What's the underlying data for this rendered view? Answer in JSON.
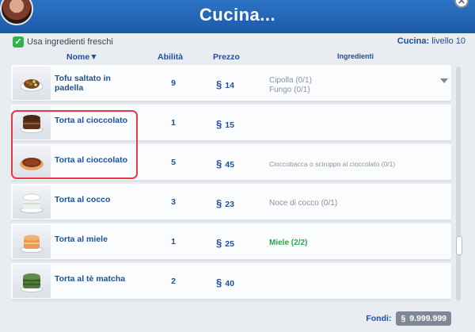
{
  "window": {
    "title": "Cucina...",
    "close_icon": "close-icon"
  },
  "options": {
    "fresh_label": "Usa ingredienti freschi",
    "fresh_checked": true
  },
  "skill": {
    "label": "Cucina:",
    "value": "livello 10"
  },
  "columns": {
    "name": "Nome",
    "skill": "Abilità",
    "price": "Prezzo",
    "ingredients": "Ingredienti"
  },
  "currency": "§",
  "recipes": [
    {
      "name": "Tofu saltato in padella",
      "skill": "9",
      "price": "14",
      "ingredients": [
        "Cipolla (0/1)",
        "Fungo (0/1)"
      ],
      "icon": "stir-fry-icon",
      "expandable": true
    },
    {
      "name": "Torta al cioccolato",
      "skill": "1",
      "price": "15",
      "ingredients": [],
      "icon": "chocolate-cake-icon"
    },
    {
      "name": "Torta al cioccolato",
      "skill": "5",
      "price": "45",
      "ingredients": [
        "Cioccobacca o sciroppo al cioccolato (0/1)"
      ],
      "icon": "chocolate-pie-icon"
    },
    {
      "name": "Torta al cocco",
      "skill": "3",
      "price": "23",
      "ingredients": [
        "Noce di cocco (0/1)"
      ],
      "icon": "coconut-cake-icon"
    },
    {
      "name": "Torta al miele",
      "skill": "1",
      "price": "25",
      "ingredients": [
        "Miele (2/2)"
      ],
      "icon": "honey-cake-icon",
      "ingredients_ready": true
    },
    {
      "name": "Torta al tè matcha",
      "skill": "2",
      "price": "40",
      "ingredients": [],
      "icon": "matcha-cake-icon"
    }
  ],
  "funds": {
    "label": "Fondi:",
    "value": "9.999.999"
  },
  "colors": {
    "header": "#1a5aa8",
    "accent_text": "#1f4f96",
    "ready": "#2fa44a",
    "highlight": "#e53945"
  }
}
